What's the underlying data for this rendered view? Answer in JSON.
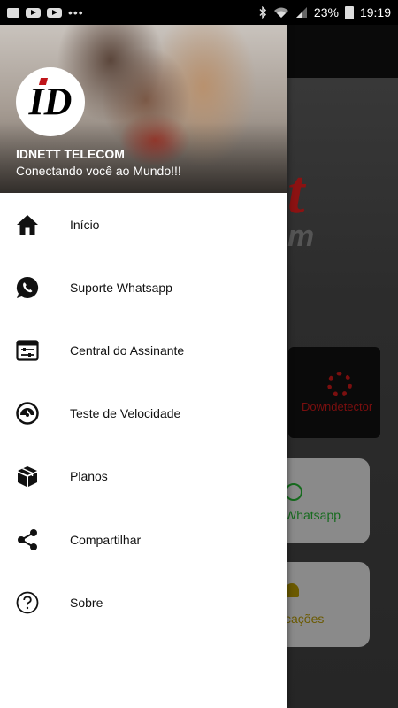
{
  "status_bar": {
    "battery": "23%",
    "time": "19:19",
    "left_icons": [
      "gallery-icon",
      "youtube-icon",
      "youtube-icon",
      "more-dots"
    ],
    "right_icons": [
      "bluetooth-icon",
      "wifi-icon",
      "signal-icon",
      "battery-icon"
    ]
  },
  "drawer": {
    "title": "IDNETT TELECOM",
    "subtitle": "Conectando você ao Mundo!!!",
    "logo_text": "ID",
    "items": [
      {
        "label": "Início",
        "icon": "home-icon"
      },
      {
        "label": "Suporte Whatsapp",
        "icon": "whatsapp-icon"
      },
      {
        "label": "Central do Assinante",
        "icon": "subscriber-panel-icon"
      },
      {
        "label": "Teste de Velocidade",
        "icon": "speedometer-icon"
      },
      {
        "label": "Planos",
        "icon": "package-icon"
      },
      {
        "label": "Compartilhar",
        "icon": "share-icon"
      },
      {
        "label": "Sobre",
        "icon": "help-icon"
      }
    ]
  },
  "background": {
    "logo_letters": "t",
    "logo_sub": "m",
    "cards": [
      {
        "label": "Downdetector",
        "icon": "gears-icon"
      },
      {
        "label": "Whatsapp",
        "icon": "whatsapp-icon"
      },
      {
        "label": "cações",
        "icon": "bell-icon"
      }
    ]
  },
  "colors": {
    "brand_red": "#c0151a",
    "whatsapp_green": "#166b1e",
    "notify_yellow": "#6b5a00"
  }
}
